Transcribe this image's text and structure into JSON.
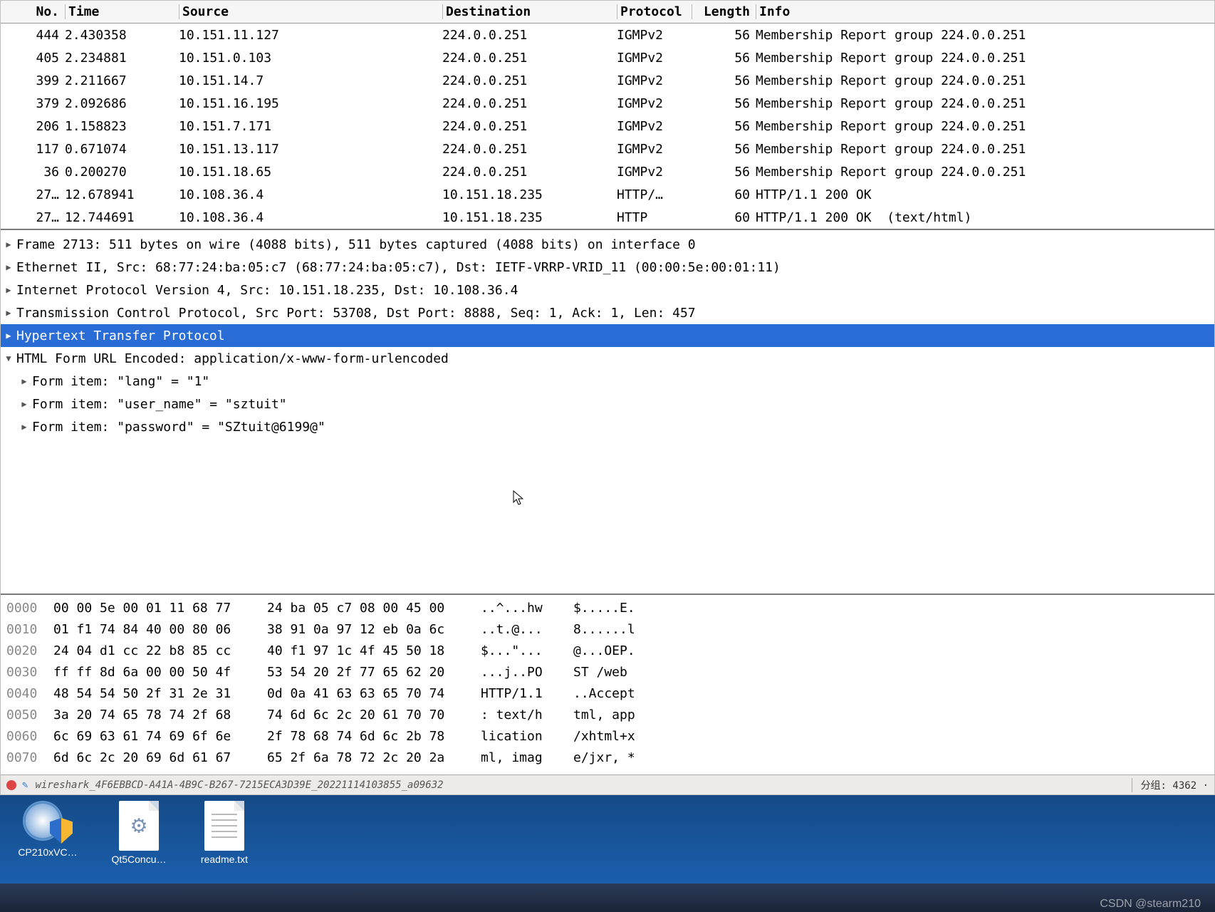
{
  "columns": {
    "no": "No.",
    "time": "Time",
    "source": "Source",
    "destination": "Destination",
    "protocol": "Protocol",
    "length": "Length",
    "info": "Info"
  },
  "packets": [
    {
      "no": "444",
      "time": "2.430358",
      "source": "10.151.11.127",
      "destination": "224.0.0.251",
      "protocol": "IGMPv2",
      "length": "56",
      "info": "Membership Report group 224.0.0.251"
    },
    {
      "no": "405",
      "time": "2.234881",
      "source": "10.151.0.103",
      "destination": "224.0.0.251",
      "protocol": "IGMPv2",
      "length": "56",
      "info": "Membership Report group 224.0.0.251"
    },
    {
      "no": "399",
      "time": "2.211667",
      "source": "10.151.14.7",
      "destination": "224.0.0.251",
      "protocol": "IGMPv2",
      "length": "56",
      "info": "Membership Report group 224.0.0.251"
    },
    {
      "no": "379",
      "time": "2.092686",
      "source": "10.151.16.195",
      "destination": "224.0.0.251",
      "protocol": "IGMPv2",
      "length": "56",
      "info": "Membership Report group 224.0.0.251"
    },
    {
      "no": "206",
      "time": "1.158823",
      "source": "10.151.7.171",
      "destination": "224.0.0.251",
      "protocol": "IGMPv2",
      "length": "56",
      "info": "Membership Report group 224.0.0.251"
    },
    {
      "no": "117",
      "time": "0.671074",
      "source": "10.151.13.117",
      "destination": "224.0.0.251",
      "protocol": "IGMPv2",
      "length": "56",
      "info": "Membership Report group 224.0.0.251"
    },
    {
      "no": "36",
      "time": "0.200270",
      "source": "10.151.18.65",
      "destination": "224.0.0.251",
      "protocol": "IGMPv2",
      "length": "56",
      "info": "Membership Report group 224.0.0.251"
    },
    {
      "no": "27…",
      "time": "12.678941",
      "source": "10.108.36.4",
      "destination": "10.151.18.235",
      "protocol": "HTTP/…",
      "length": "60",
      "info": "HTTP/1.1 200 OK"
    },
    {
      "no": "27…",
      "time": "12.744691",
      "source": "10.108.36.4",
      "destination": "10.151.18.235",
      "protocol": "HTTP",
      "length": "60",
      "info": "HTTP/1.1 200 OK  (text/html)"
    }
  ],
  "tree": {
    "frame": "Frame 2713: 511 bytes on wire (4088 bits), 511 bytes captured (4088 bits) on interface 0",
    "eth": "Ethernet II, Src: 68:77:24:ba:05:c7 (68:77:24:ba:05:c7), Dst: IETF-VRRP-VRID_11 (00:00:5e:00:01:11)",
    "ip": "Internet Protocol Version 4, Src: 10.151.18.235, Dst: 10.108.36.4",
    "tcp": "Transmission Control Protocol, Src Port: 53708, Dst Port: 8888, Seq: 1, Ack: 1, Len: 457",
    "http": "Hypertext Transfer Protocol",
    "form_hdr": "HTML Form URL Encoded: application/x-www-form-urlencoded",
    "form1": "Form item: \"lang\" = \"1\"",
    "form2": "Form item: \"user_name\" = \"sztuit\"",
    "form3": "Form item: \"password\" = \"SZtuit@6199@\""
  },
  "hex": [
    {
      "off": "0000",
      "a": "00 00 5e 00 01 11 68 77",
      "b": "24 ba 05 c7 08 00 45 00",
      "c": "..^...hw",
      "d": "$.....E."
    },
    {
      "off": "0010",
      "a": "01 f1 74 84 40 00 80 06",
      "b": "38 91 0a 97 12 eb 0a 6c",
      "c": "..t.@...",
      "d": "8......l"
    },
    {
      "off": "0020",
      "a": "24 04 d1 cc 22 b8 85 cc",
      "b": "40 f1 97 1c 4f 45 50 18",
      "c": "$...\"...",
      "d": "@...OEP."
    },
    {
      "off": "0030",
      "a": "ff ff 8d 6a 00 00 50 4f",
      "b": "53 54 20 2f 77 65 62 20",
      "c": "...j..PO",
      "d": "ST /web "
    },
    {
      "off": "0040",
      "a": "48 54 54 50 2f 31 2e 31",
      "b": "0d 0a 41 63 63 65 70 74",
      "c": "HTTP/1.1",
      "d": "..Accept"
    },
    {
      "off": "0050",
      "a": "3a 20 74 65 78 74 2f 68",
      "b": "74 6d 6c 2c 20 61 70 70",
      "c": ": text/h",
      "d": "tml, app"
    },
    {
      "off": "0060",
      "a": "6c 69 63 61 74 69 6f 6e",
      "b": "2f 78 68 74 6d 6c 2b 78",
      "c": "lication",
      "d": "/xhtml+x"
    },
    {
      "off": "0070",
      "a": "6d 6c 2c 20 69 6d 61 67",
      "b": "65 2f 6a 78 72 2c 20 2a",
      "c": "ml, imag",
      "d": "e/jxr, *"
    }
  ],
  "status": {
    "file": "wireshark_4F6EBBCD-A41A-4B9C-B267-7215ECA3D39E_20221114103855_a09632",
    "group": "分组: 4362 ·"
  },
  "desktop": {
    "ico1": "CP210xVC…",
    "ico2": "Qt5Concu…",
    "ico3": "readme.txt"
  },
  "watermark": "CSDN @stearm210"
}
